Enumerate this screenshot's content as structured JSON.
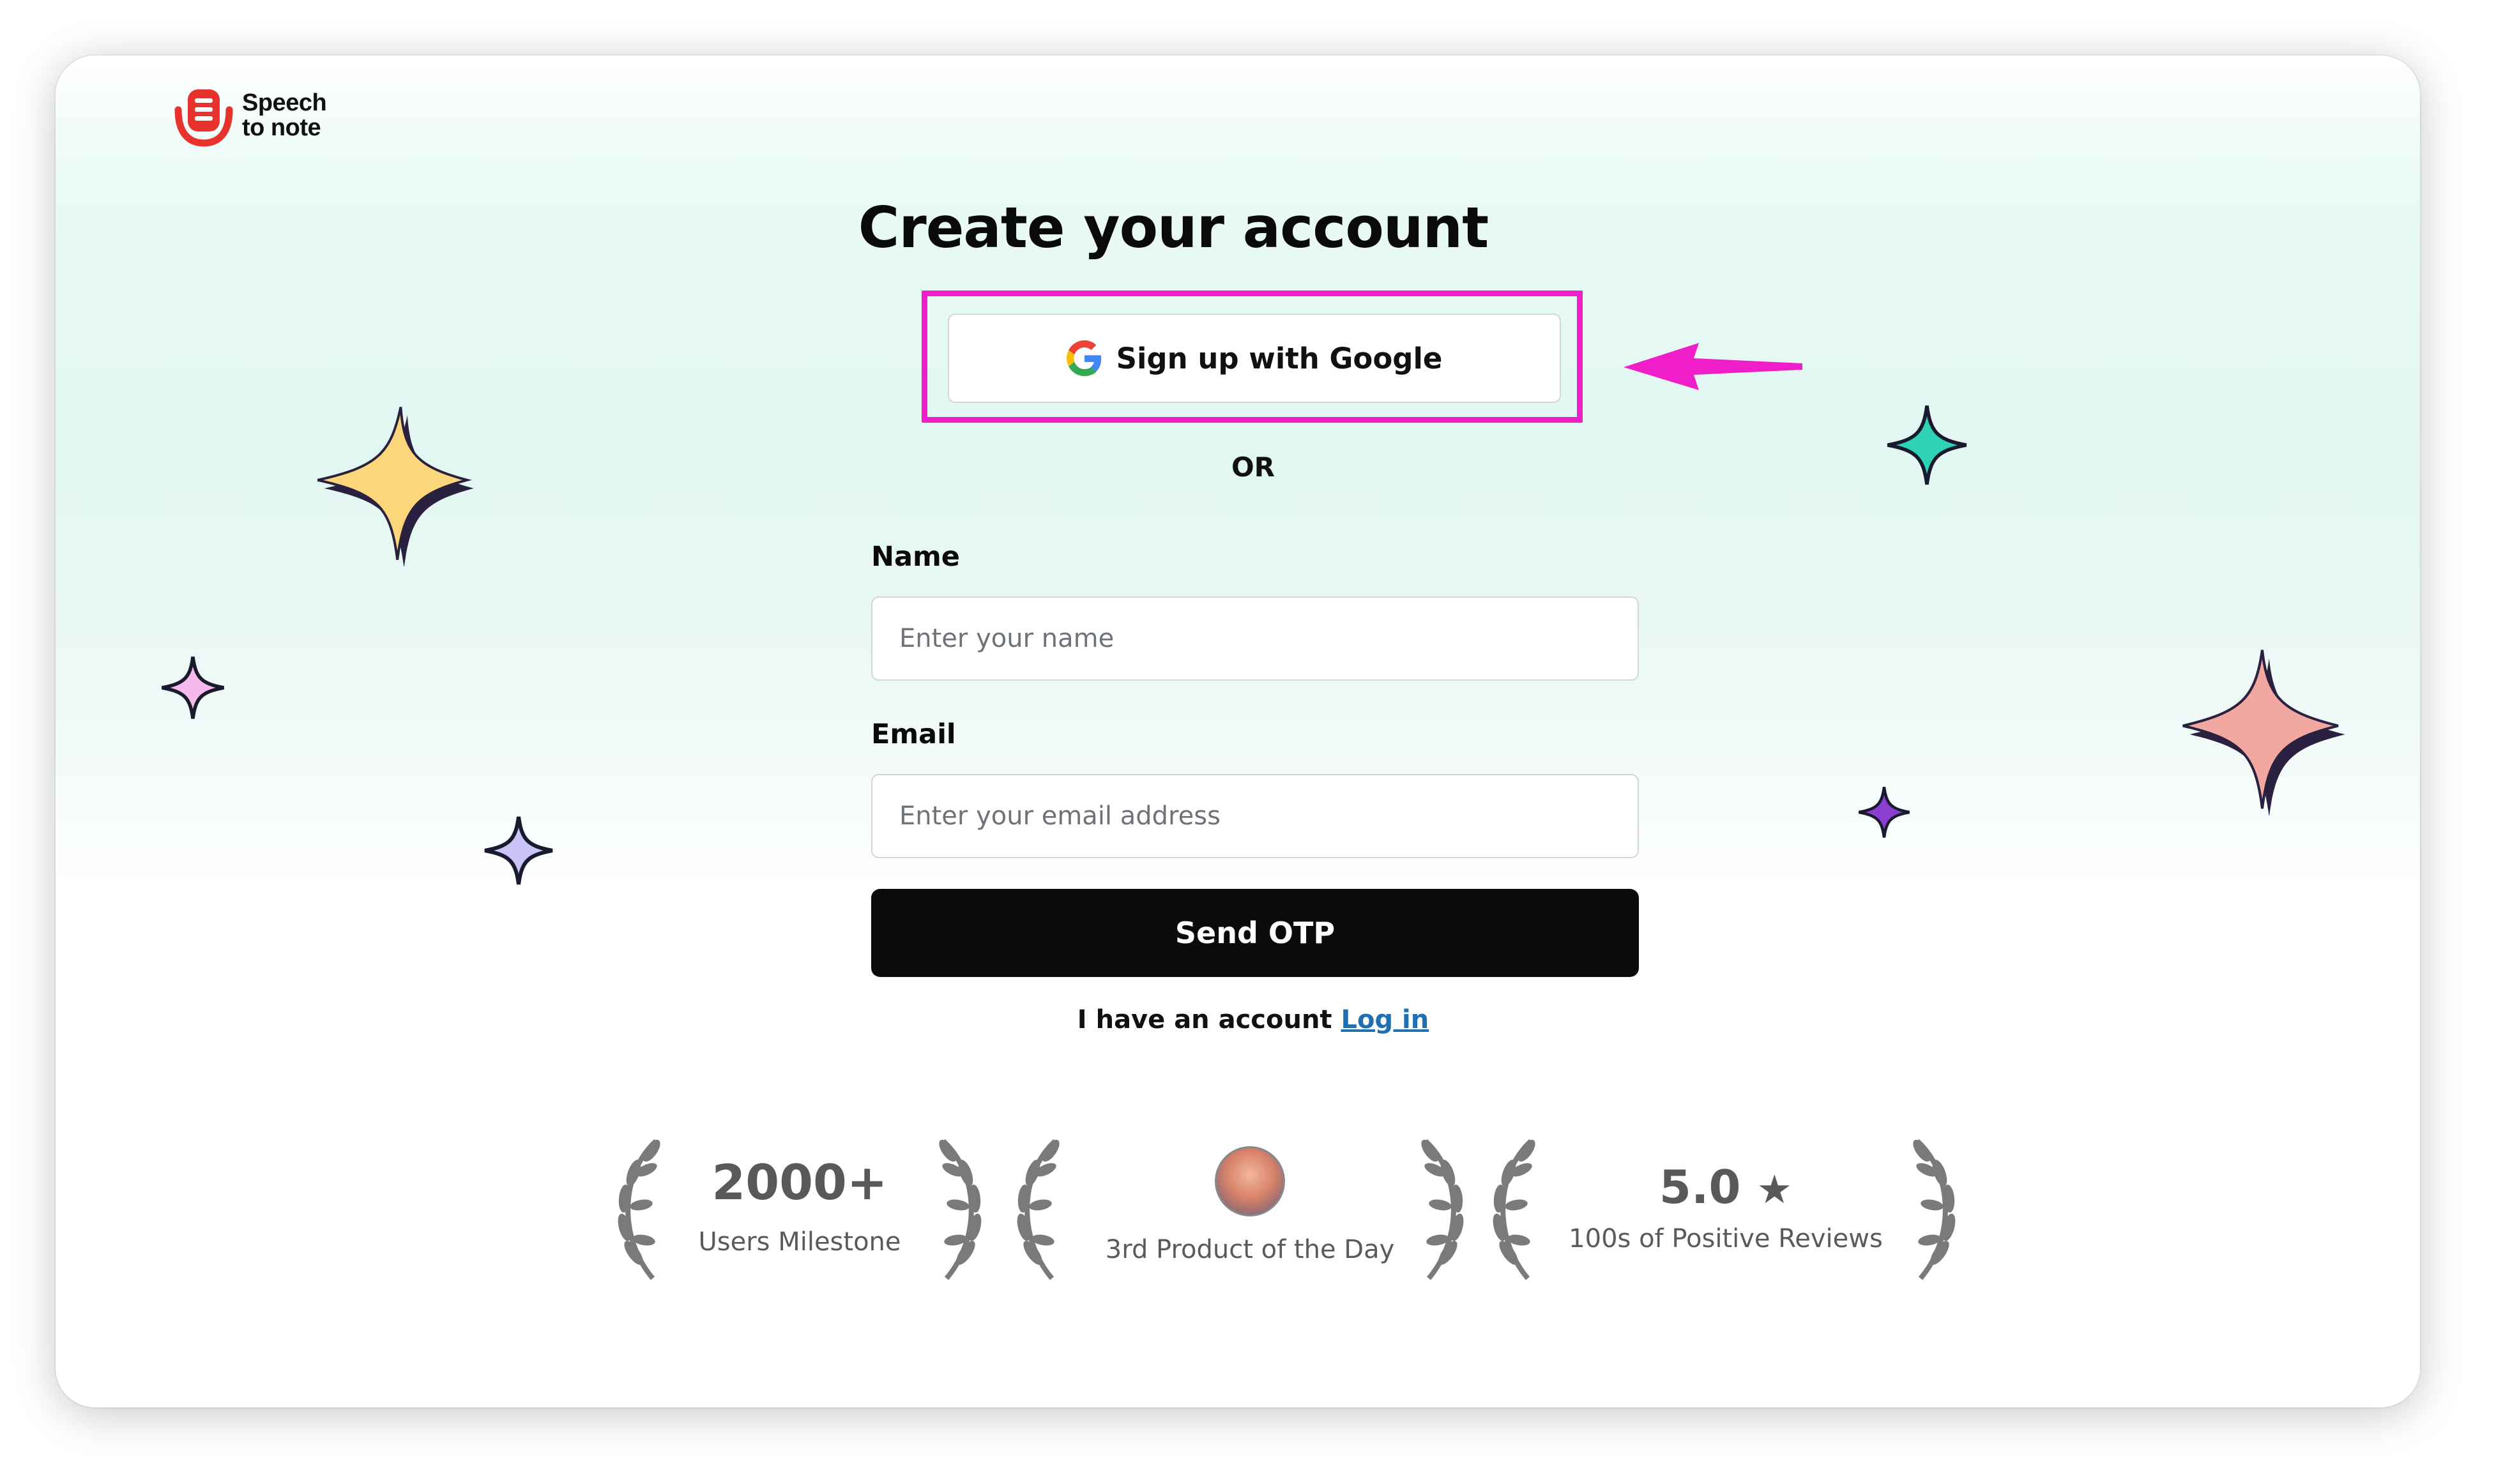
{
  "brand": {
    "name_line1": "Speech",
    "name_line2": "to note",
    "logo_color": "#e8322e"
  },
  "page": {
    "title": "Create your account",
    "google_button_label": "Sign up with Google",
    "divider": "OR",
    "annotation_color": "#f01ec8"
  },
  "form": {
    "name_label": "Name",
    "name_placeholder": "Enter your name",
    "email_label": "Email",
    "email_placeholder": "Enter your email address",
    "submit_label": "Send OTP",
    "account_prompt": "I have an account",
    "login_link": "Log in"
  },
  "badges": [
    {
      "value": "2000+",
      "caption": "Users Milestone"
    },
    {
      "value": "",
      "caption": "3rd Product of the Day"
    },
    {
      "value": "5.0",
      "caption": "100s of Positive Reviews"
    }
  ],
  "decor": {
    "star_colors": [
      "#fbd67a",
      "#f2a7a0",
      "#2ed3b7",
      "#f5b9ec",
      "#c9c4f5",
      "#8b3fd1"
    ]
  }
}
